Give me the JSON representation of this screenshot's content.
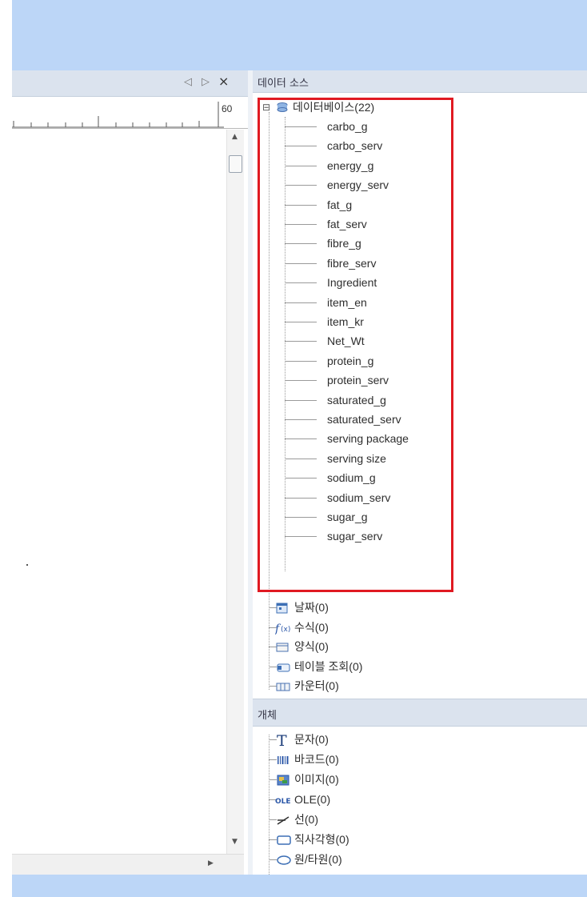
{
  "left_panel": {
    "nav_prev": "◁",
    "nav_next": "▷",
    "close": "×",
    "ruler_number": "60"
  },
  "data_source": {
    "title": "데이터 소스",
    "database": {
      "label": "데이터베이스(22)",
      "expand": "⊟",
      "fields": [
        "carbo_g",
        "carbo_serv",
        "energy_g",
        "energy_serv",
        "fat_g",
        "fat_serv",
        "fibre_g",
        "fibre_serv",
        "Ingredient",
        "item_en",
        "item_kr",
        "Net_Wt",
        "protein_g",
        "protein_serv",
        "saturated_g",
        "saturated_serv",
        "serving package",
        "serving size",
        "sodium_g",
        "sodium_serv",
        "sugar_g",
        "sugar_serv"
      ]
    },
    "other_items": [
      {
        "label": "날짜(0)",
        "icon": "calendar-icon"
      },
      {
        "label": "수식(0)",
        "icon": "formula-icon"
      },
      {
        "label": "양식(0)",
        "icon": "form-icon"
      },
      {
        "label": "테이블 조회(0)",
        "icon": "table-lookup-icon"
      },
      {
        "label": "카운터(0)",
        "icon": "counter-icon"
      }
    ]
  },
  "objects": {
    "title": "개체",
    "items": [
      {
        "label": "문자(0)",
        "icon": "text-icon"
      },
      {
        "label": "바코드(0)",
        "icon": "barcode-icon"
      },
      {
        "label": "이미지(0)",
        "icon": "image-icon"
      },
      {
        "label": "OLE(0)",
        "icon": "ole-icon"
      },
      {
        "label": "선(0)",
        "icon": "line-icon"
      },
      {
        "label": "직사각형(0)",
        "icon": "rectangle-icon"
      },
      {
        "label": "원/타원(0)",
        "icon": "ellipse-icon"
      }
    ]
  },
  "colors": {
    "highlight": "#e01a22",
    "header": "#dbe3ee",
    "title_bar": "#bcd6f7"
  }
}
